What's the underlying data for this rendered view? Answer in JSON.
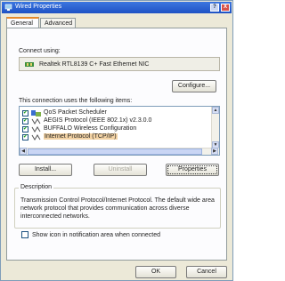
{
  "window": {
    "title": "Wired Properties",
    "help_label": "?",
    "close_label": "X"
  },
  "tabs": [
    {
      "label": "General",
      "selected": true
    },
    {
      "label": "Advanced",
      "selected": false
    }
  ],
  "connect_using": {
    "label": "Connect using:",
    "adapter": "Realtek RTL8139 C+ Fast Ethernet NIC",
    "configure_button": "Configure..."
  },
  "items_section": {
    "label": "This connection uses the following items:",
    "items": [
      {
        "label": "QoS Packet Scheduler",
        "checked": true,
        "icon": "scheduler-icon",
        "selected": false
      },
      {
        "label": "AEGIS Protocol (IEEE 802.1x) v2.3.0.0",
        "checked": true,
        "icon": "protocol-icon",
        "selected": false
      },
      {
        "label": "BUFFALO Wireless Configuration",
        "checked": true,
        "icon": "protocol-icon",
        "selected": false
      },
      {
        "label": "Internet Protocol (TCP/IP)",
        "checked": true,
        "icon": "protocol-icon",
        "selected": true
      }
    ],
    "check_mark": "✔"
  },
  "actions": {
    "install": "Install...",
    "uninstall": "Uninstall",
    "properties": "Properties"
  },
  "description": {
    "title": "Description",
    "text": "Transmission Control Protocol/Internet Protocol. The default wide area network protocol that provides communication across diverse interconnected networks."
  },
  "show_icon": {
    "label": "Show icon in notification area when connected",
    "checked": false
  },
  "footer": {
    "ok": "OK",
    "cancel": "Cancel"
  },
  "colors": {
    "title_bar": "#1f52c4",
    "dialog_bg": "#ece9d8",
    "selection": "#f2d2a4",
    "tab_highlight": "#e68b2c"
  }
}
